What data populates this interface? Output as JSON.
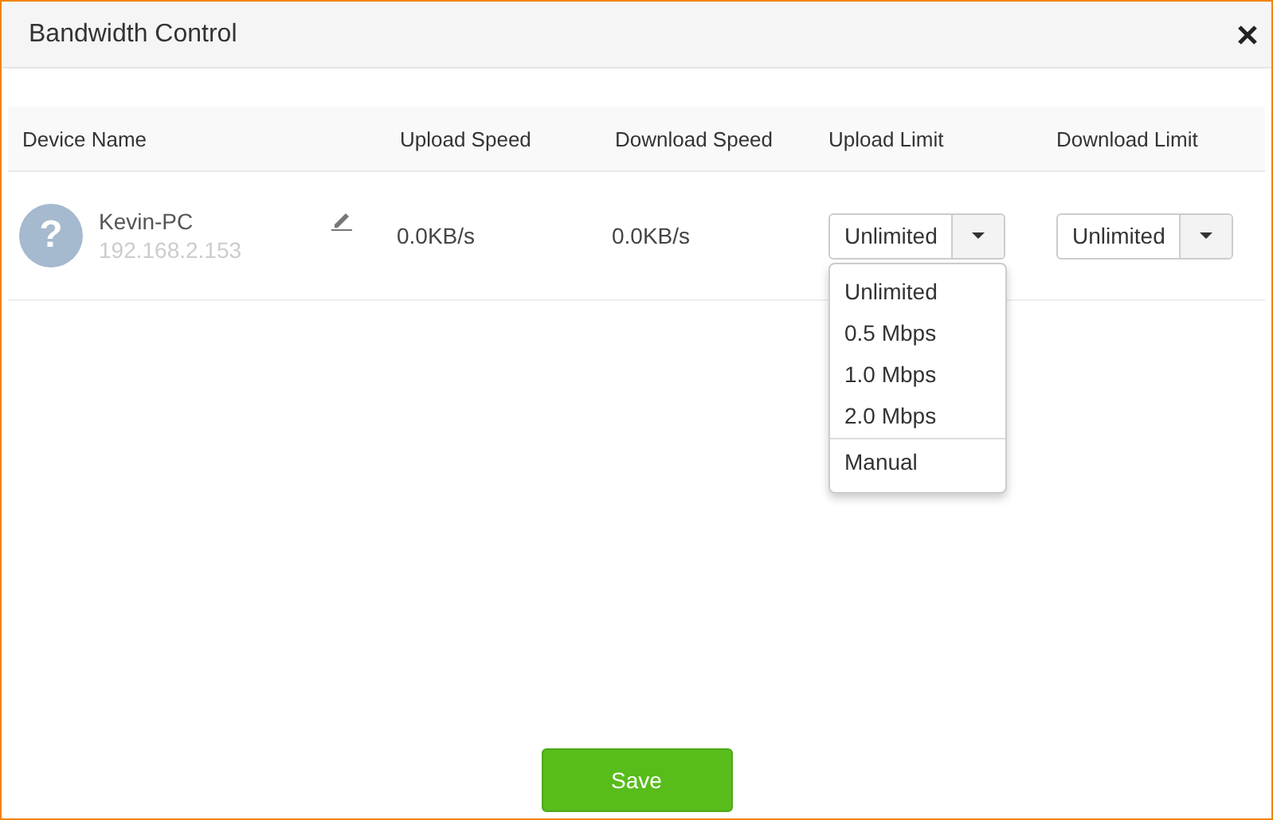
{
  "window": {
    "title": "Bandwidth Control"
  },
  "table": {
    "columns": [
      "Device Name",
      "Upload Speed",
      "Download Speed",
      "Upload Limit",
      "Download Limit"
    ],
    "rows": [
      {
        "avatar": "?",
        "name": "Kevin-PC",
        "ip": "192.168.2.153",
        "upload_speed": "0.0KB/s",
        "download_speed": "0.0KB/s",
        "upload_limit": {
          "value": "Unlimited",
          "menu_options": [
            {
              "label": "Unlimited",
              "separator_before": false
            },
            {
              "label": "0.5 Mbps",
              "separator_before": false
            },
            {
              "label": "1.0 Mbps",
              "separator_before": false
            },
            {
              "label": "2.0 Mbps",
              "separator_before": false
            },
            {
              "label": "Manual",
              "separator_before": true
            }
          ]
        },
        "download_limit": {
          "value": "Unlimited"
        }
      }
    ]
  },
  "buttons": [
    "Save"
  ]
}
